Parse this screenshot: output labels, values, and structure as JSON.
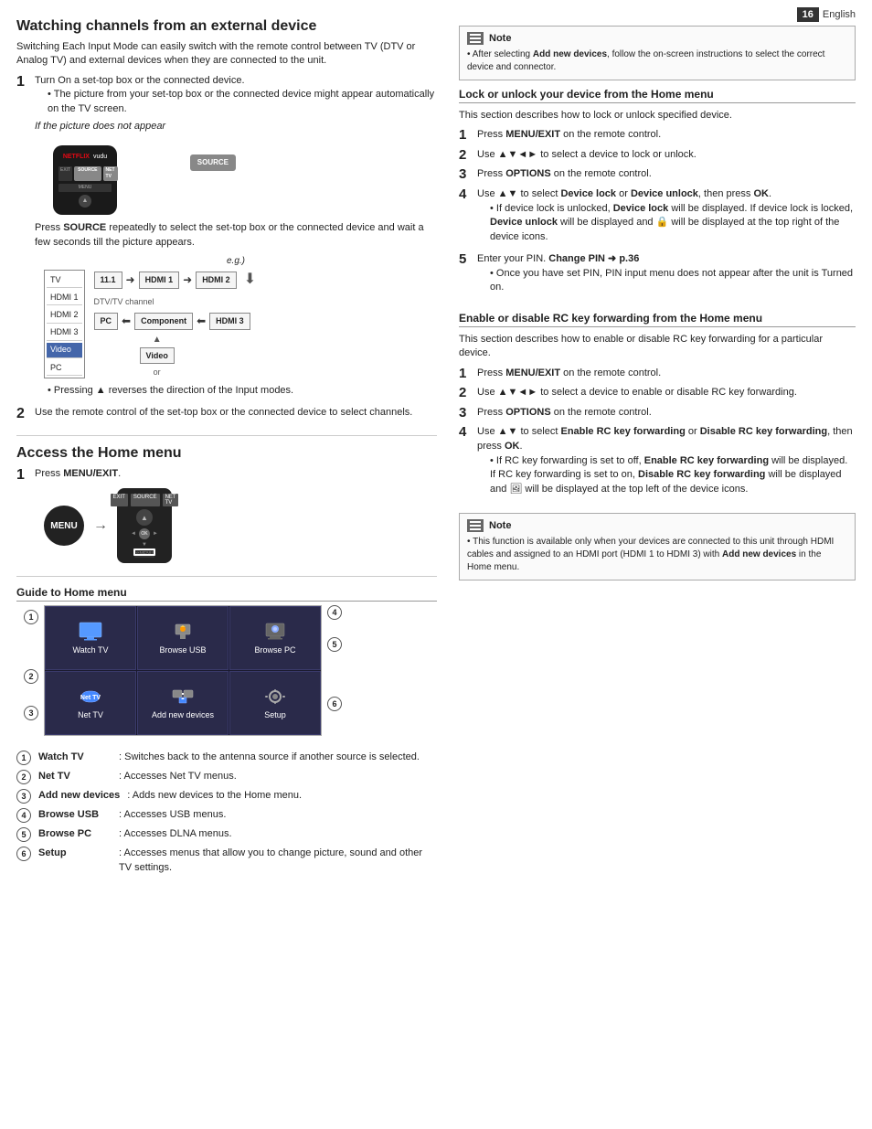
{
  "page": {
    "number": "16",
    "language": "English"
  },
  "left": {
    "section1": {
      "heading": "Watching channels from an external device",
      "intro": "Switching Each Input Mode can easily switch with the remote control between TV (DTV or Analog TV) and external devices when they are connected to the unit.",
      "step1": {
        "num": "1",
        "text": "Turn On a set-top box or the connected device.",
        "bullets": [
          "The picture from your set-top box or the connected device might appear automatically on the TV screen."
        ],
        "italic_label": "If the picture does not appear",
        "source_note": "Press SOURCE repeatedly to select the set-top box or the connected device and wait a few seconds till the picture appears.",
        "eg_label": "e.g.",
        "input_items": [
          "TV",
          "HDMI 1",
          "HDMI 2",
          "HDMI 3",
          "Video",
          "PC"
        ],
        "selected_input": "Video",
        "flow": [
          "11.1",
          "HDMI 1",
          "HDMI 2"
        ],
        "flow2": [
          "PC",
          "Component",
          "HDMI 3"
        ],
        "dtv_label": "DTV/TV channel",
        "video_label": "Video",
        "or_label": "or",
        "pressing_note": "Pressing ▲ reverses the direction of the Input modes."
      },
      "step2": {
        "num": "2",
        "text": "Use the remote control of the set-top box or the connected device to select channels."
      }
    },
    "section2": {
      "heading": "Access the Home menu",
      "step1": {
        "num": "1",
        "text": "Press MENU/EXIT."
      }
    },
    "section3": {
      "heading": "Guide to Home menu",
      "menu_items": [
        {
          "id": "1",
          "label": "Watch TV",
          "pos": "r1c1"
        },
        {
          "id": "4",
          "label": "Browse USB",
          "pos": "r1c2"
        },
        {
          "id": "5",
          "label": "Browse PC",
          "pos": "r1c3"
        },
        {
          "id": "2",
          "label": "Net TV",
          "pos": "r2c1"
        },
        {
          "id": "6",
          "label": "Add new devices",
          "pos": "r2c2"
        },
        {
          "id": "3",
          "label": "Setup",
          "pos": "r2c3"
        }
      ],
      "legend": [
        {
          "num": "1",
          "name": "Watch TV",
          "desc": ": Switches back to the antenna source if another source is selected."
        },
        {
          "num": "2",
          "name": "Net TV",
          "desc": ": Accesses Net TV menus."
        },
        {
          "num": "3",
          "name": "Add new devices",
          "desc": ": Adds new devices to the Home menu."
        },
        {
          "num": "4",
          "name": "Browse USB",
          "desc": ": Accesses USB menus."
        },
        {
          "num": "5",
          "name": "Browse PC",
          "desc": ": Accesses DLNA menus."
        },
        {
          "num": "6",
          "name": "Setup",
          "desc": ": Accesses menus that allow you to change picture, sound and other TV settings."
        }
      ]
    }
  },
  "right": {
    "note1": {
      "title": "Note",
      "content": "After selecting Add new devices, follow the on-screen instructions to select the correct device and connector."
    },
    "section1": {
      "heading": "Lock or unlock your device from the Home menu",
      "intro": "This section describes how to lock or unlock specified device.",
      "steps": [
        {
          "num": "1",
          "text": "Press MENU/EXIT on the remote control."
        },
        {
          "num": "2",
          "text": "Use ▲▼◄► to select a device to lock or unlock."
        },
        {
          "num": "3",
          "text": "Press OPTIONS on the remote control."
        },
        {
          "num": "4",
          "text": "Use ▲▼ to select Device lock or Device unlock, then press OK.\n• If device lock is unlocked, Device lock will be displayed. If device lock is locked, Device unlock will be displayed and 🔒 will be displayed at the top right of the device icons."
        },
        {
          "num": "5",
          "text": "Enter your PIN. Change PIN ➜ p.36\n• Once you have set PIN, PIN input menu does not appear after the unit is Turned on."
        }
      ]
    },
    "section2": {
      "heading": "Enable or disable RC key forwarding from the Home menu",
      "intro": "This section describes how to enable or disable RC key forwarding for a particular device.",
      "steps": [
        {
          "num": "1",
          "text": "Press MENU/EXIT on the remote control."
        },
        {
          "num": "2",
          "text": "Use ▲▼◄► to select a device to enable or disable RC key forwarding."
        },
        {
          "num": "3",
          "text": "Press OPTIONS on the remote control."
        },
        {
          "num": "4",
          "text": "Use ▲▼ to select Enable RC key forwarding or Disable RC key forwarding, then press OK.\n• If RC key forwarding is set to off, Enable RC key forwarding will be displayed. If RC key forwarding is set to on, Disable RC key forwarding will be displayed and 🔲 will be displayed at the top left of the device icons."
        }
      ]
    },
    "note2": {
      "title": "Note",
      "content": "This function is available only when your devices are connected to this unit through HDMI cables and assigned to an HDMI port (HDMI 1 to HDMI 3) with Add new devices in the Home menu."
    }
  }
}
